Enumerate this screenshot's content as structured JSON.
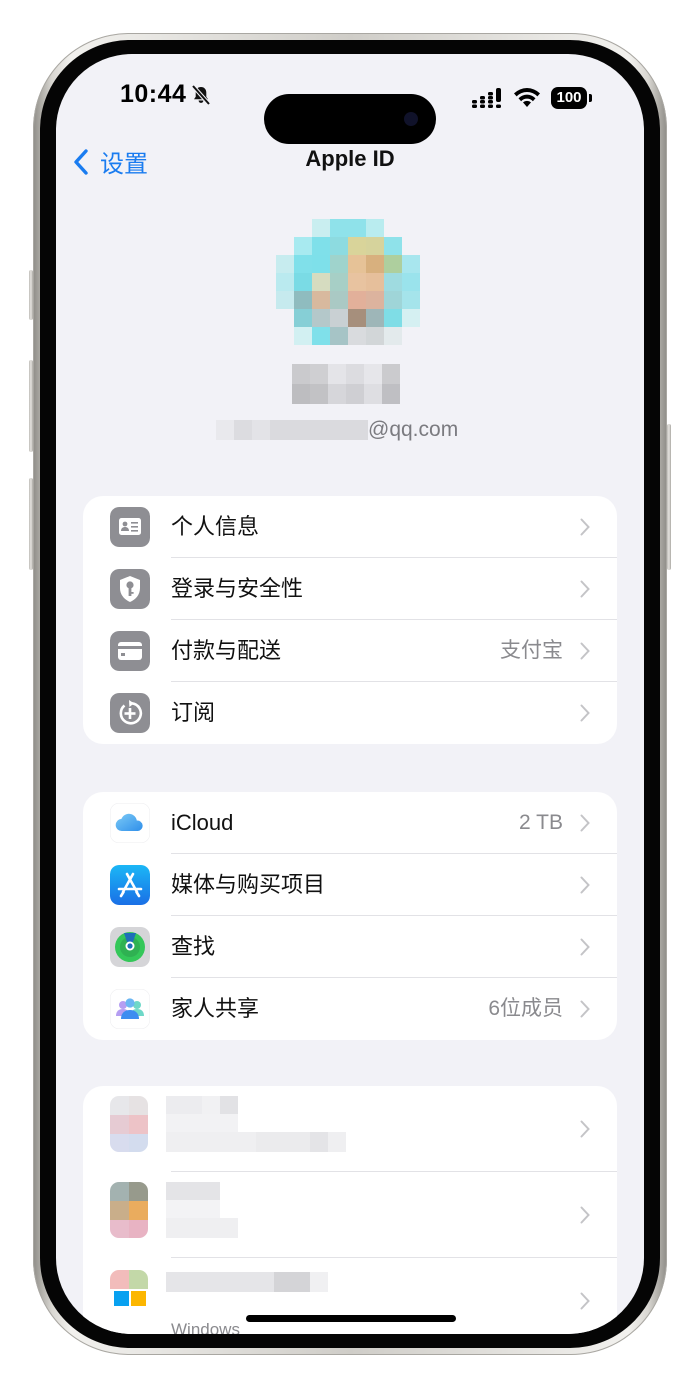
{
  "status_bar": {
    "time": "10:44",
    "silent_mode": true,
    "battery_level": "100",
    "signal_icon": "cellular-signal-icon",
    "wifi_icon": "wifi-icon"
  },
  "nav": {
    "back_label": "设置",
    "title": "Apple ID"
  },
  "profile": {
    "name": "",
    "email_suffix": "@qq.com"
  },
  "groups": [
    {
      "items": [
        {
          "label": "个人信息",
          "value": "",
          "icon": "contact-card-icon"
        },
        {
          "label": "登录与安全性",
          "value": "",
          "icon": "shield-key-icon"
        },
        {
          "label": "付款与配送",
          "value": "支付宝",
          "icon": "credit-card-icon"
        },
        {
          "label": "订阅",
          "value": "",
          "icon": "subscription-icon"
        }
      ]
    },
    {
      "items": [
        {
          "label": "iCloud",
          "value": "2 TB",
          "icon": "icloud-icon"
        },
        {
          "label": "媒体与购买项目",
          "value": "",
          "icon": "app-store-icon"
        },
        {
          "label": "查找",
          "value": "",
          "icon": "find-my-icon"
        },
        {
          "label": "家人共享",
          "value": "6位成员",
          "icon": "family-sharing-icon"
        }
      ]
    },
    {
      "devices": [
        {
          "name": "",
          "model": ""
        },
        {
          "name": "",
          "model": ""
        },
        {
          "name": "",
          "model": "Windows"
        }
      ]
    }
  ],
  "colors": {
    "accent": "#1a7cf0",
    "background": "#f2f2f7",
    "secondary_text": "#8a8a8e"
  }
}
